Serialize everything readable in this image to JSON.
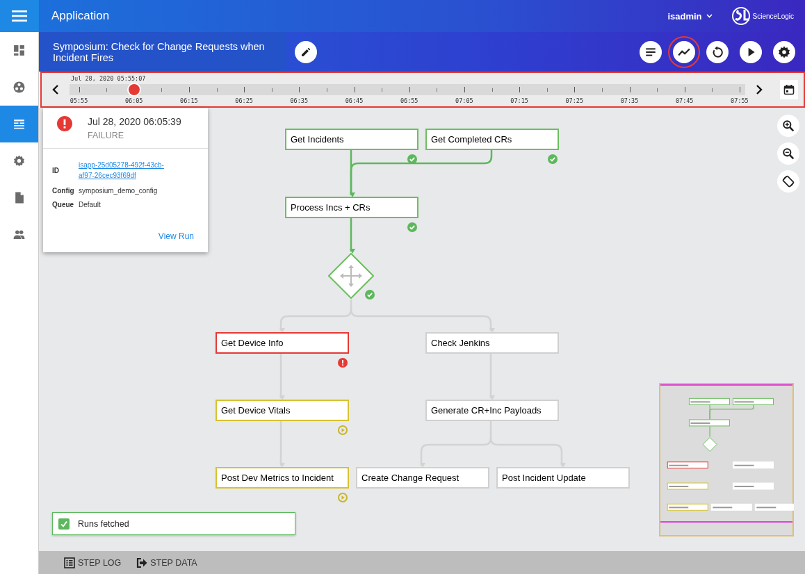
{
  "app": {
    "title": "Application",
    "user": "isadmin",
    "logo_text": "ScienceLogic"
  },
  "sidebar": {
    "items": [
      {
        "kind": "dashboard",
        "selected": false
      },
      {
        "kind": "apps",
        "selected": false
      },
      {
        "kind": "flows",
        "selected": true
      },
      {
        "kind": "settings",
        "selected": false
      },
      {
        "kind": "document",
        "selected": false
      },
      {
        "kind": "people",
        "selected": false
      }
    ]
  },
  "header": {
    "title": "Symposium: Check for Change Requests when Incident Fires",
    "tools": [
      {
        "kind": "list",
        "selected": false
      },
      {
        "kind": "chart",
        "selected": true
      },
      {
        "kind": "replay",
        "selected": false
      },
      {
        "kind": "play",
        "selected": false
      },
      {
        "kind": "settings",
        "selected": false
      }
    ]
  },
  "timeline": {
    "cursor_label": "Jul 28, 2020 05:55:07",
    "ticks": [
      {
        "label": "05:55",
        "has_run": false
      },
      {
        "label": "06:05",
        "has_run": true
      },
      {
        "label": "06:15",
        "has_run": false
      },
      {
        "label": "06:25",
        "has_run": false
      },
      {
        "label": "06:35",
        "has_run": false
      },
      {
        "label": "06:45",
        "has_run": false
      },
      {
        "label": "06:55",
        "has_run": false
      },
      {
        "label": "07:05",
        "has_run": false
      },
      {
        "label": "07:15",
        "has_run": false
      },
      {
        "label": "07:25",
        "has_run": false
      },
      {
        "label": "07:35",
        "has_run": false
      },
      {
        "label": "07:45",
        "has_run": false
      },
      {
        "label": "07:55",
        "has_run": false
      }
    ]
  },
  "run_popup": {
    "time": "Jul 28, 2020 06:05:39",
    "status": "FAILURE",
    "fields": [
      {
        "label": "ID",
        "value": "isapp-25d05278-492f-43cb-af97-26cec93f69df",
        "kind": "link"
      },
      {
        "label": "Config",
        "value": "symposium_demo_config",
        "kind": "text"
      },
      {
        "label": "Queue",
        "value": "Default",
        "kind": "text"
      }
    ],
    "action": "View Run"
  },
  "steps": [
    {
      "kind": "task",
      "label": "Get Incidents",
      "done": true,
      "failed": false,
      "running": false
    },
    {
      "kind": "task",
      "label": "Get Completed CRs",
      "done": true,
      "failed": false,
      "running": false
    },
    {
      "kind": "task",
      "label": "Process Incs + CRs",
      "done": true,
      "failed": false,
      "running": false
    },
    {
      "kind": "decision",
      "done": true,
      "failed": false,
      "running": false
    },
    {
      "kind": "task",
      "label": "Get Device Info",
      "done": false,
      "failed": true,
      "running": false
    },
    {
      "kind": "task",
      "label": "Check Jenkins",
      "done": false,
      "failed": false,
      "running": false
    },
    {
      "kind": "task",
      "label": "Get Device Vitals",
      "done": false,
      "failed": false,
      "running": true
    },
    {
      "kind": "task",
      "label": "Generate CR+Inc Payloads",
      "done": false,
      "failed": false,
      "running": false
    },
    {
      "kind": "task",
      "label": "Post Dev Metrics to Incident",
      "done": false,
      "failed": false,
      "running": true
    },
    {
      "kind": "task",
      "label": "Create Change Request",
      "done": false,
      "failed": false,
      "running": false
    },
    {
      "kind": "task",
      "label": "Post Incident Update",
      "done": false,
      "failed": false,
      "running": false
    }
  ],
  "toast": {
    "text": "Runs fetched"
  },
  "bottom_tabs": [
    {
      "kind": "log",
      "label": "STEP LOG"
    },
    {
      "kind": "data",
      "label": "STEP DATA"
    }
  ]
}
